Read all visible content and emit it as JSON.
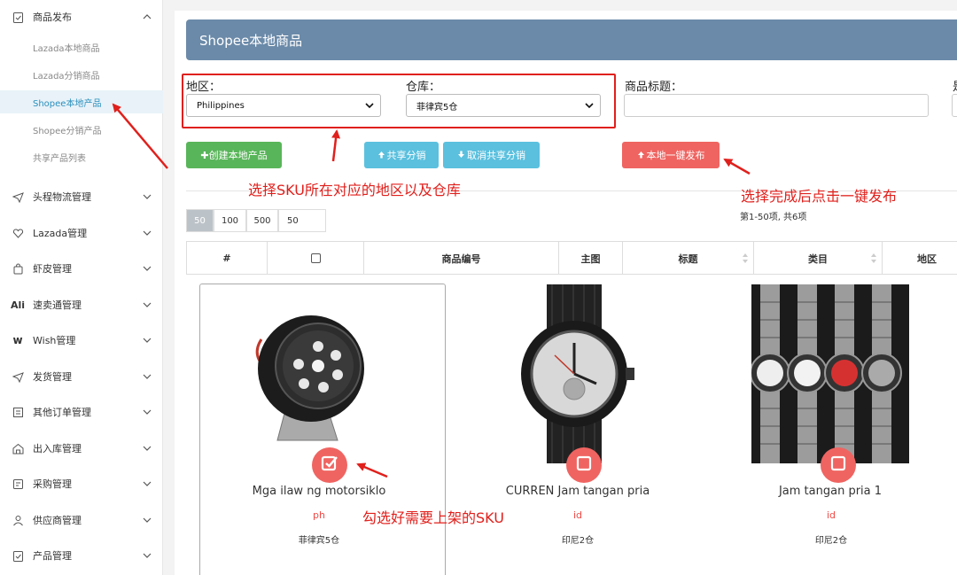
{
  "sidebar": {
    "groups": [
      {
        "label": "商品发布",
        "icon": "clipboard-check-icon",
        "expanded": true
      },
      {
        "label": "头程物流管理",
        "icon": "plane-icon"
      },
      {
        "label": "Lazada管理",
        "icon": "heart-icon"
      },
      {
        "label": "虾皮管理",
        "icon": "shopping-bag-icon"
      },
      {
        "label": "速卖通管理",
        "icon": "aliexpress-icon"
      },
      {
        "label": "Wish管理",
        "icon": "wish-icon"
      },
      {
        "label": "发货管理",
        "icon": "plane-icon"
      },
      {
        "label": "其他订单管理",
        "icon": "list-icon"
      },
      {
        "label": "出入库管理",
        "icon": "warehouse-icon"
      },
      {
        "label": "采购管理",
        "icon": "purchase-icon"
      },
      {
        "label": "供应商管理",
        "icon": "supplier-icon"
      },
      {
        "label": "产品管理",
        "icon": "clipboard-check-icon"
      }
    ],
    "subitems": [
      "Lazada本地商品",
      "Lazada分销商品",
      "Shopee本地产品",
      "Shopee分销产品",
      "共享产品列表"
    ],
    "active_subitem": "Shopee本地产品"
  },
  "header": {
    "title": "Shopee本地商品"
  },
  "filters": {
    "region_label": "地区：",
    "region_value": "Philippines",
    "warehouse_label": "仓库：",
    "warehouse_value": "菲律宾5仓",
    "title_label": "商品标题：",
    "extra_label": "是"
  },
  "buttons": {
    "create": "✚创建本地产品",
    "share": "共享分销",
    "unshare": "取消共享分销",
    "publish": "本地一键发布"
  },
  "annotations": {
    "select_region": "选择SKU所在对应的地区以及仓库",
    "publish_hint": "选择完成后点击一键发布",
    "check_hint": "勾选好需要上架的SKU"
  },
  "pagination": {
    "sizes": [
      "50",
      "100",
      "500"
    ],
    "selected": "50",
    "custom_value": "50",
    "info": "第1-50项, 共6项"
  },
  "table": {
    "headers": [
      "#",
      "",
      "商品编号",
      "主图",
      "标题",
      "类目",
      "地区"
    ]
  },
  "products": [
    {
      "title": "Mga ilaw ng motorsiklo",
      "region": "ph",
      "warehouse": "菲律宾5仓",
      "checked": true
    },
    {
      "title": "CURREN Jam tangan pria",
      "region": "id",
      "warehouse": "印尼2仓",
      "checked": false
    },
    {
      "title": "Jam tangan pria 1",
      "region": "id",
      "warehouse": "印尼2仓",
      "checked": false
    }
  ],
  "colors": {
    "accent": "#ef6461",
    "header": "#6b8aa9",
    "annotation": "#e0201c",
    "active": "#2a8fbd"
  }
}
